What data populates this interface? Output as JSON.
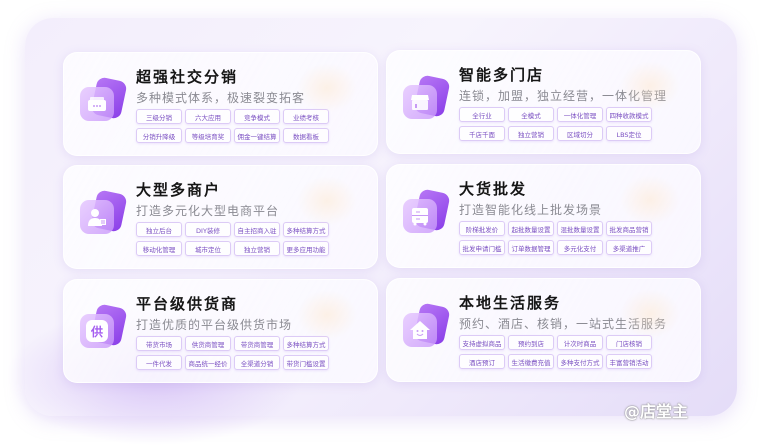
{
  "cards": [
    {
      "title": "超强社交分销",
      "subtitle": "多种模式体系，极速裂变拓客",
      "icon": "shop-icon",
      "tags": [
        "三级分销",
        "六大应用",
        "竞争模式",
        "业绩考核",
        "分销升降级",
        "等级培育奖",
        "佣金一键结算",
        "数据看板"
      ]
    },
    {
      "title": "智能多门店",
      "subtitle": "连锁，加盟，独立经营，一体化管理",
      "icon": "storefront-icon",
      "tags": [
        "全行业",
        "全模式",
        "一体化管理",
        "四种收款模式",
        "千店千面",
        "独立营销",
        "区域切分",
        "LBS定位"
      ]
    },
    {
      "title": "大型多商户",
      "subtitle": "打造多元化大型电商平台",
      "icon": "merchant-user-icon",
      "tags": [
        "独立后台",
        "DIY装修",
        "自主招商入驻",
        "多种结算方式",
        "移动化管理",
        "城市定位",
        "独立营销",
        "更多应用功能"
      ]
    },
    {
      "title": "大货批发",
      "subtitle": "打造智能化线上批发场景",
      "icon": "wholesale-cabinet-icon",
      "tags": [
        "阶梯批发价",
        "起批数量设置",
        "混批数量设置",
        "批发商品营销",
        "批发申请门槛",
        "订单数据管理",
        "多元化支付",
        "多渠道推广"
      ]
    },
    {
      "title": "平台级供货商",
      "subtitle": "打造优质的平台级供货市场",
      "icon": "supplier-icon",
      "icon_text": "供",
      "tags": [
        "带货市场",
        "供货商管理",
        "带货商管理",
        "多种结算方式",
        "一件代发",
        "商品统一经价",
        "全渠道分销",
        "带货门槛设置"
      ]
    },
    {
      "title": "本地生活服务",
      "subtitle": "预约、酒店、核销，一站式生活服务",
      "icon": "home-smile-icon",
      "tags": [
        "支持虚拟商品",
        "预约到店",
        "计次时商品",
        "门店核销",
        "酒店预订",
        "生活缴费充值",
        "多种支付方式",
        "丰富营销活动"
      ]
    }
  ],
  "watermark": "@店堂主"
}
